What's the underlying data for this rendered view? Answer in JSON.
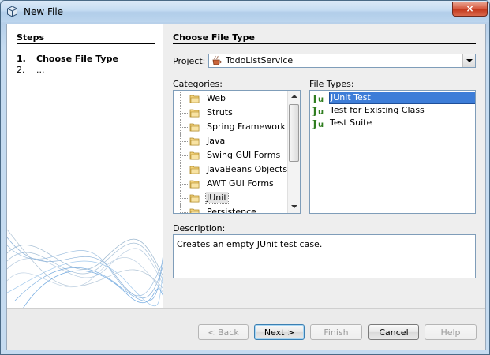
{
  "window": {
    "title": "New File",
    "close_label": "×"
  },
  "steps": {
    "title": "Steps",
    "items": [
      {
        "num": "1.",
        "label": "Choose File Type",
        "active": true
      },
      {
        "num": "2.",
        "label": "...",
        "active": false
      }
    ]
  },
  "main": {
    "header": "Choose File Type",
    "project_label": "Project:",
    "project_value": "TodoListService",
    "categories_label": "Categories:",
    "categories": [
      "Web",
      "Struts",
      "Spring Framework",
      "Java",
      "Swing GUI Forms",
      "JavaBeans Objects",
      "AWT GUI Forms",
      "JUnit",
      "Persistence"
    ],
    "selected_category": "JUnit",
    "file_types_label": "File Types:",
    "file_types": [
      "JUnit Test",
      "Test for Existing Class",
      "Test Suite"
    ],
    "selected_file_type": "JUnit Test",
    "description_label": "Description:",
    "description": "Creates an empty JUnit test case."
  },
  "buttons": {
    "back": "< Back",
    "next": "Next >",
    "finish": "Finish",
    "cancel": "Cancel",
    "help": "Help"
  },
  "colors": {
    "selection": "#3d7dd8",
    "titlebar": "#c5dcf2",
    "close": "#c2371b"
  }
}
